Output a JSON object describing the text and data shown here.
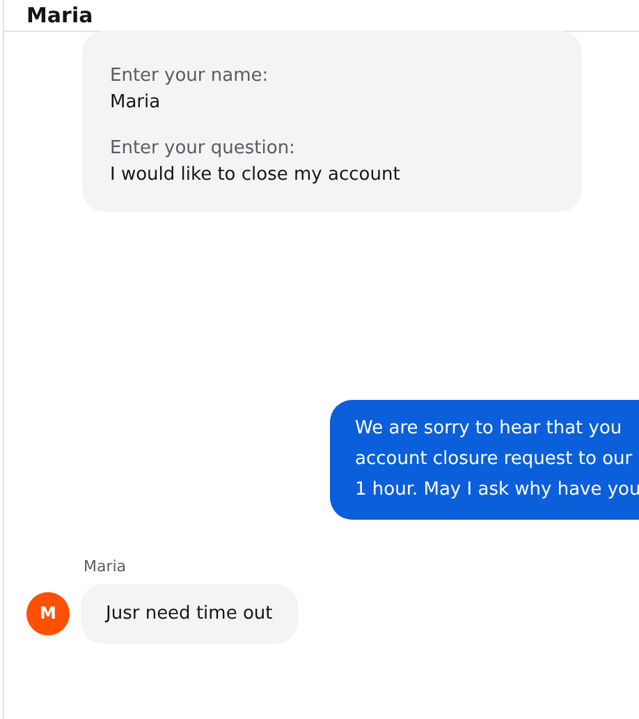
{
  "header": {
    "title": "Maria"
  },
  "form_card": {
    "fields": [
      {
        "label": "Enter your name:",
        "value": "Maria"
      },
      {
        "label": "Enter your question:",
        "value": "I would like to close my account"
      }
    ]
  },
  "messages": [
    {
      "kind": "agent",
      "lines": [
        "We are sorry to hear that you",
        "account closure request to our",
        "1 hour. May I ask why have you"
      ]
    },
    {
      "kind": "visitor",
      "sender": "Maria",
      "avatar": "M",
      "text": "Jusr need time out"
    }
  ]
}
